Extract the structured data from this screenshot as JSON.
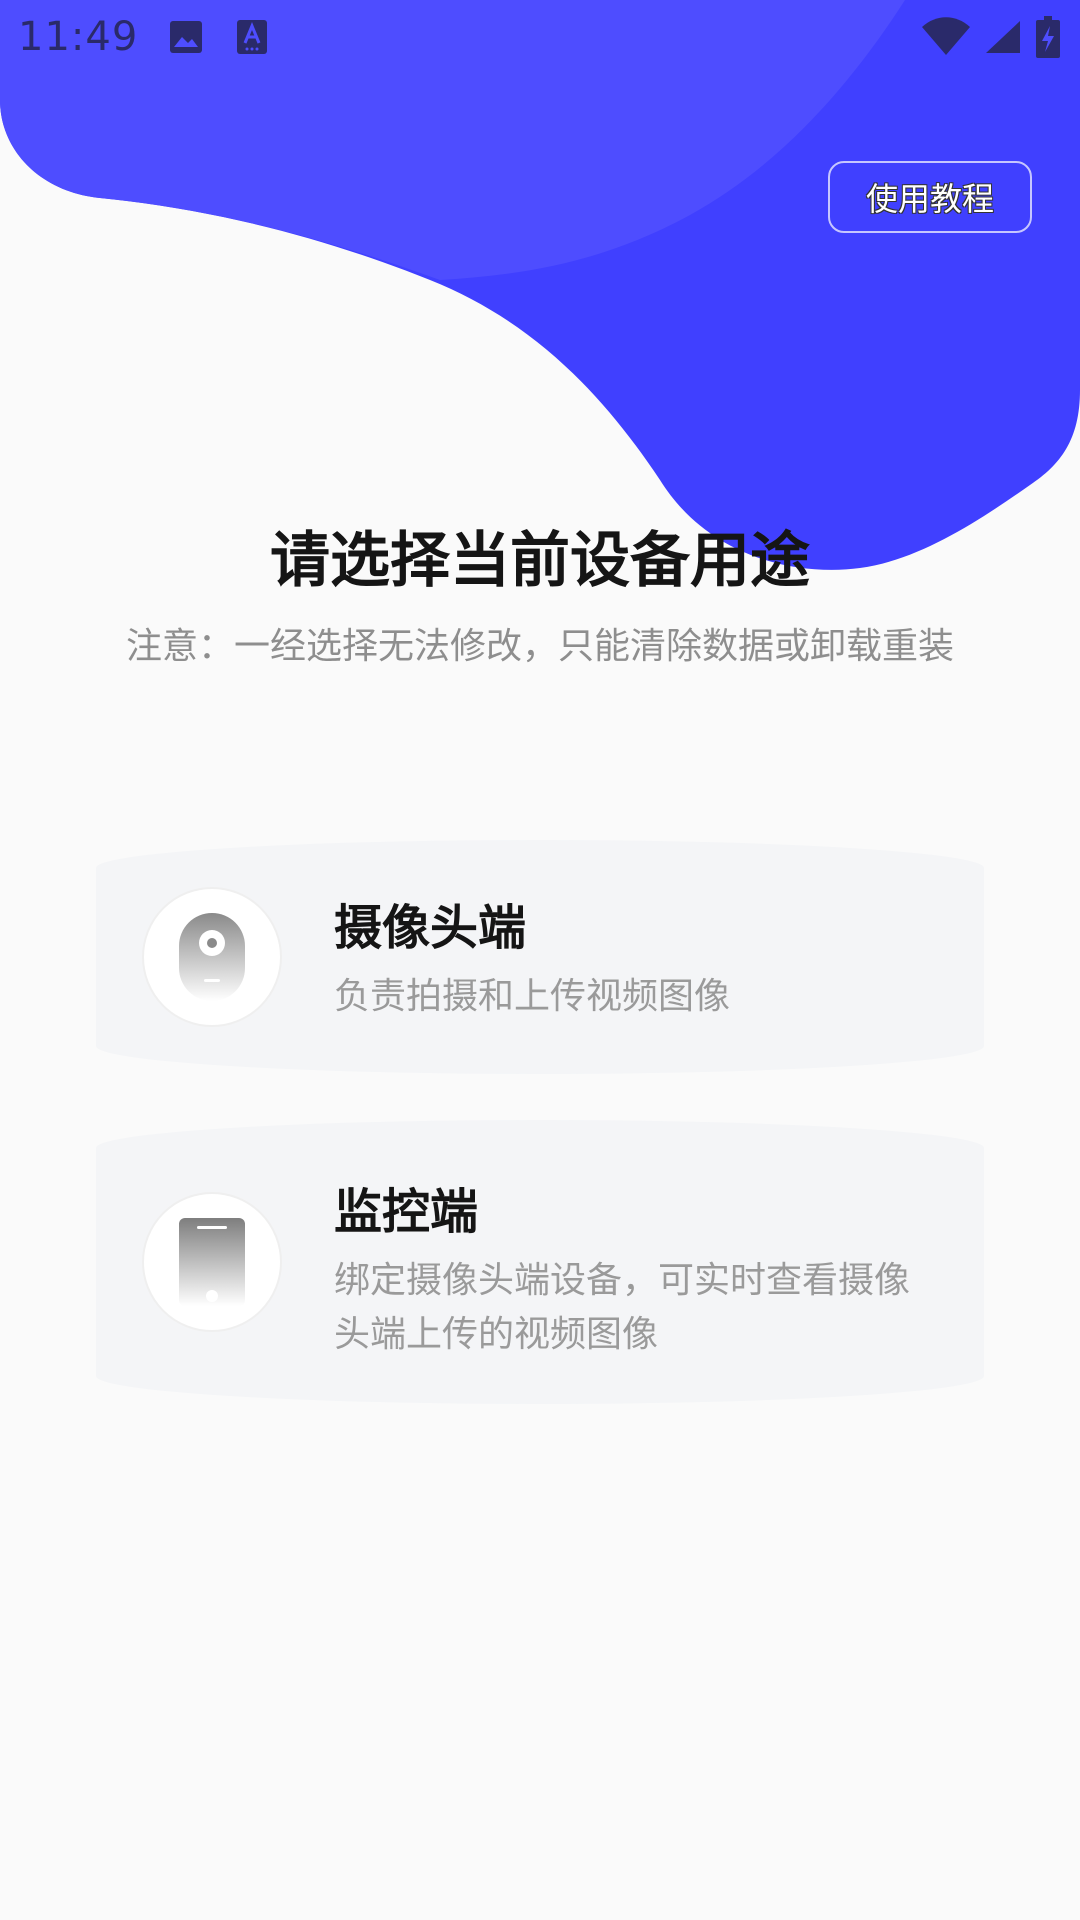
{
  "status_bar": {
    "time": "11:49",
    "icons": [
      "gallery-icon",
      "a-icon",
      "wifi-icon",
      "signal-icon",
      "battery-icon"
    ]
  },
  "header": {
    "tutorial_label": "使用教程"
  },
  "main": {
    "title": "请选择当前设备用途",
    "subtitle": "注意：一经选择无法修改，只能清除数据或卸载重装",
    "options": [
      {
        "title": "摄像头端",
        "description": "负责拍摄和上传视频图像",
        "icon": "camera-icon"
      },
      {
        "title": "监控端",
        "description": "绑定摄像头端设备，可实时查看摄像头端上传的视频图像",
        "icon": "phone-icon"
      }
    ]
  },
  "colors": {
    "accent": "#4040FF",
    "accent_light": "#5250FF",
    "background": "#FAFAFA",
    "card_bg": "#F4F5F7"
  }
}
